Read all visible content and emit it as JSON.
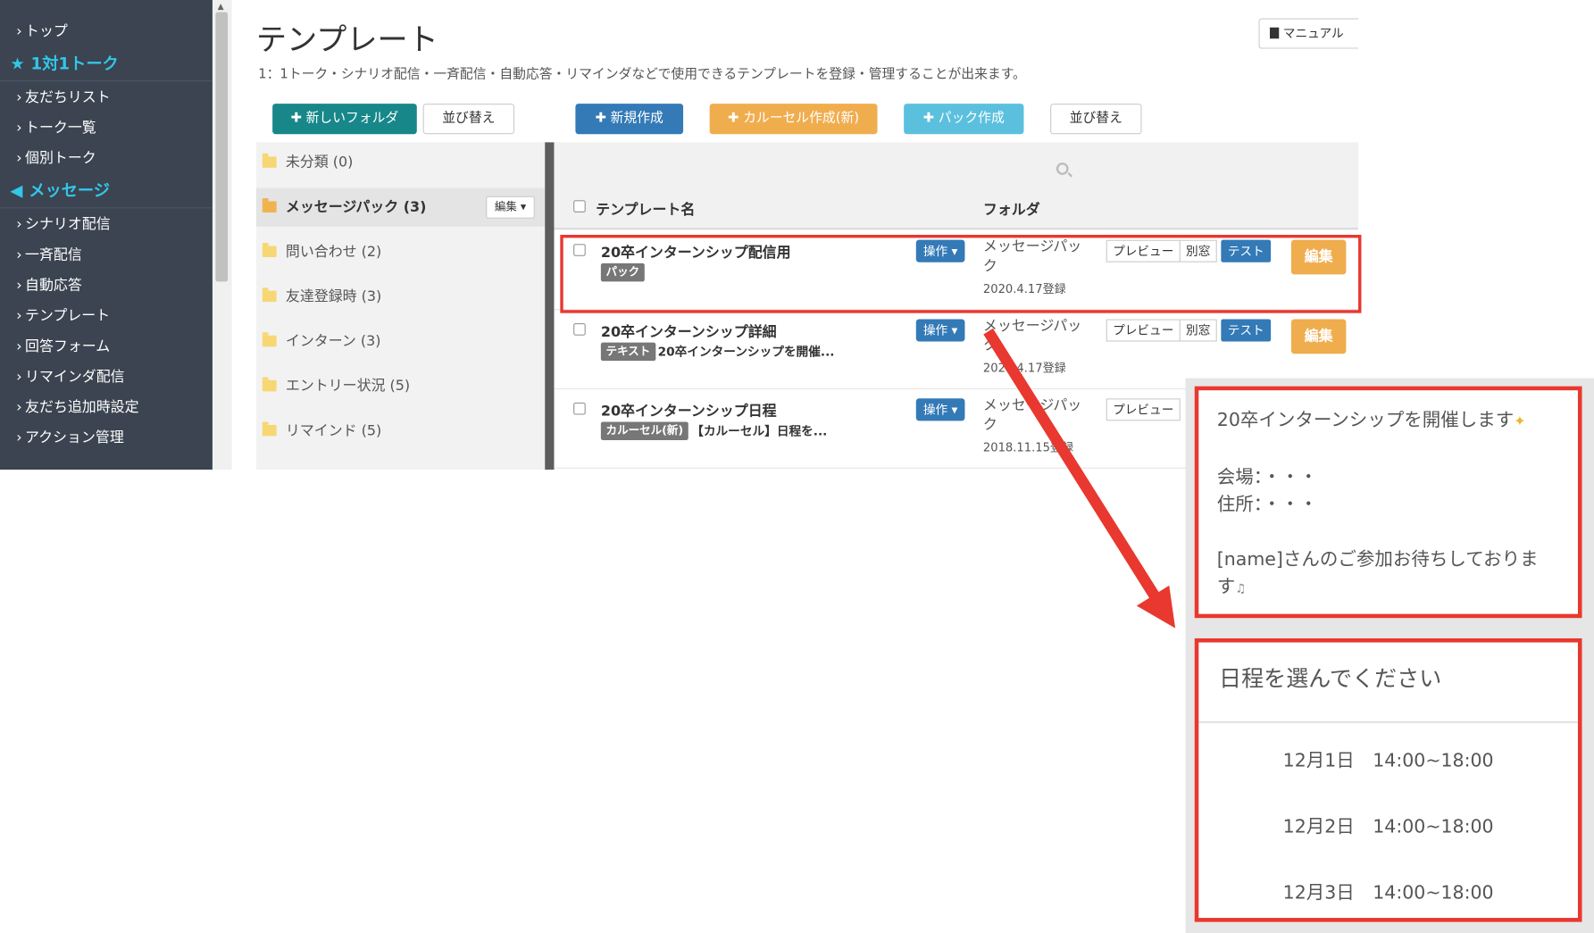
{
  "sidebar": {
    "items": [
      {
        "label": "トップ"
      },
      {
        "label": "友だちリスト"
      },
      {
        "label": "トーク一覧"
      },
      {
        "label": "個別トーク"
      },
      {
        "label": "シナリオ配信"
      },
      {
        "label": "一斉配信"
      },
      {
        "label": "自動応答"
      },
      {
        "label": "テンプレート"
      },
      {
        "label": "回答フォーム"
      },
      {
        "label": "リマインダ配信"
      },
      {
        "label": "友だち追加時設定"
      },
      {
        "label": "アクション管理"
      }
    ],
    "sections": [
      {
        "label": "1対1トーク",
        "icon": "star-icon"
      },
      {
        "label": "メッセージ",
        "icon": "megaphone-icon"
      }
    ],
    "colors": {
      "background": "#3b4450",
      "section": "#33c6ea"
    }
  },
  "header": {
    "title": "テンプレート",
    "description": "1：1トーク・シナリオ配信・一斉配信・自動応答・リマインダなどで使用できるテンプレートを登録・管理することが出来ます。",
    "manual_label": "マニュアル"
  },
  "toolbar": {
    "new_folder": "新しいフォルダ",
    "sort_folders": "並び替え",
    "new_create": "新規作成",
    "carousel_create": "カルーセル作成(新)",
    "pack_create": "パック作成",
    "sort_templates": "並び替え",
    "colors": {
      "new_folder": "#17878a",
      "new_create": "#337ab7",
      "carousel": "#f0ad4e",
      "pack": "#5bc0de"
    }
  },
  "folders": [
    {
      "label": "未分類 (0)"
    },
    {
      "label": "メッセージパック (3)",
      "edit_label": "編集"
    },
    {
      "label": "問い合わせ (2)"
    },
    {
      "label": "友達登録時 (3)"
    },
    {
      "label": "インターン (3)"
    },
    {
      "label": "エントリー状況 (5)"
    },
    {
      "label": "リマインド (5)"
    }
  ],
  "table": {
    "col_name": "テンプレート名",
    "col_folder": "フォルダ",
    "op_label": "操作",
    "preview_label": "プレビュー",
    "window_label": "別窓",
    "test_label": "テスト",
    "edit_label": "編集",
    "rows": [
      {
        "name": "20卒インターンシップ配信用",
        "badge": "パック",
        "subtext": "",
        "folder_line1": "メッセージパッ",
        "folder_line2": "ク",
        "date": "2020.4.17登録"
      },
      {
        "name": "20卒インターンシップ詳細",
        "badge": "テキスト",
        "subtext": "20卒インターンシップを開催...",
        "folder_line1": "メッセージパッ",
        "folder_line2": "ク",
        "date": "2020.4.17登録"
      },
      {
        "name": "20卒インターンシップ日程",
        "badge": "カルーセル(新)",
        "subtext": "【カルーセル】日程を...",
        "folder_line1": "メッセージパッ",
        "folder_line2": "ク",
        "date": "2018.11.15登録"
      }
    ]
  },
  "preview": {
    "message": {
      "line1": "20卒インターンシップを開催します",
      "line2": "会場：・・・",
      "line3": "住所：・・・",
      "line4": "[name]さんのご参加お待ちしておりま",
      "line5": "す"
    },
    "carousel": {
      "title": "日程を選んでください",
      "options": [
        "12月1日　14:00~18:00",
        "12月2日　14:00~18:00",
        "12月3日　14:00~18:00"
      ]
    },
    "highlight_color": "#e8382f"
  }
}
